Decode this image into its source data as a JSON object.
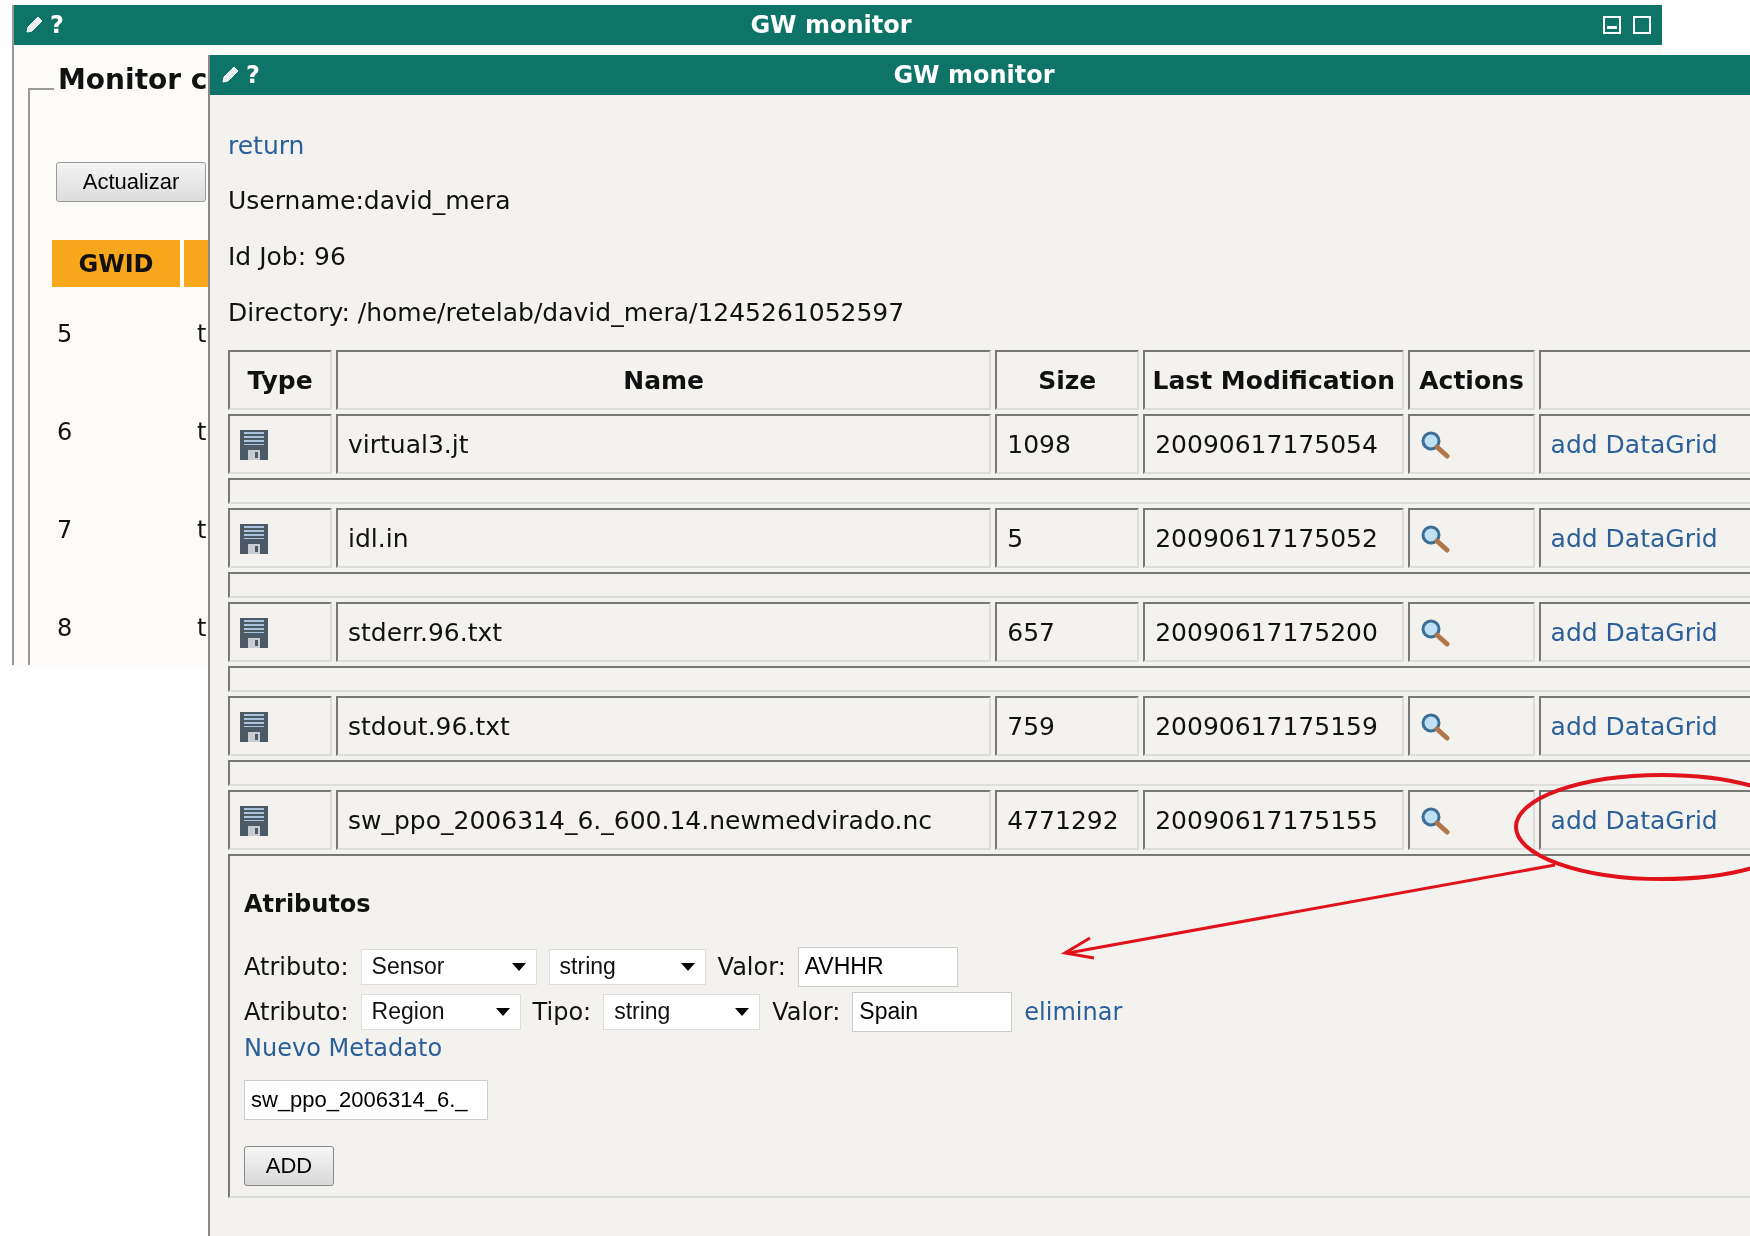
{
  "back_window": {
    "title": "GW monitor",
    "help": "?",
    "legend": "Monitor c",
    "refresh_button": "Actualizar",
    "columns": [
      "GWID"
    ],
    "rows": [
      {
        "gwid": "5",
        "column_2": "t"
      },
      {
        "gwid": "6",
        "column_2": "t"
      },
      {
        "gwid": "7",
        "column_2": "t"
      },
      {
        "gwid": "8",
        "column_2": "t"
      }
    ]
  },
  "front_window": {
    "title": "GW monitor",
    "help": "?",
    "return_link": "return",
    "info": [
      "Username:david_mera",
      "Id Job: 96",
      "Directory: /home/retelab/david_mera/1245261052597"
    ],
    "columns": [
      "Type",
      "Name",
      "Size",
      "Last Modification",
      "Actions"
    ],
    "files": [
      {
        "name": "virtual3.jt",
        "size": "1098",
        "modified": "20090617175054",
        "link": "add DataGrid",
        "expanded": false
      },
      {
        "name": "idl.in",
        "size": "5",
        "modified": "20090617175052",
        "link": "add DataGrid",
        "expanded": false
      },
      {
        "name": "stderr.96.txt",
        "size": "657",
        "modified": "20090617175200",
        "link": "add DataGrid",
        "expanded": false
      },
      {
        "name": "stdout.96.txt",
        "size": "759",
        "modified": "20090617175159",
        "link": "add DataGrid",
        "expanded": false
      },
      {
        "name": "sw_ppo_2006314_6._600.14.newmedvirado.nc",
        "size": "4771292",
        "modified": "20090617175155",
        "link": "add DataGrid",
        "expanded": true
      }
    ],
    "attributes": {
      "heading": "Atributos",
      "rows": [
        {
          "label": "Atributo:",
          "attribute": "Sensor",
          "type": "string",
          "value_label": "Valor:",
          "value": "AVHHR"
        },
        {
          "label": "Atributo:",
          "attribute": "Region",
          "type_label": "Tipo:",
          "type": "string",
          "value_label": "Valor:",
          "value": "Spain",
          "remove_link": "eliminar"
        }
      ],
      "new_link": "Nuevo Metadato",
      "file_field": "sw_ppo_2006314_6._",
      "add_button": "ADD"
    }
  }
}
